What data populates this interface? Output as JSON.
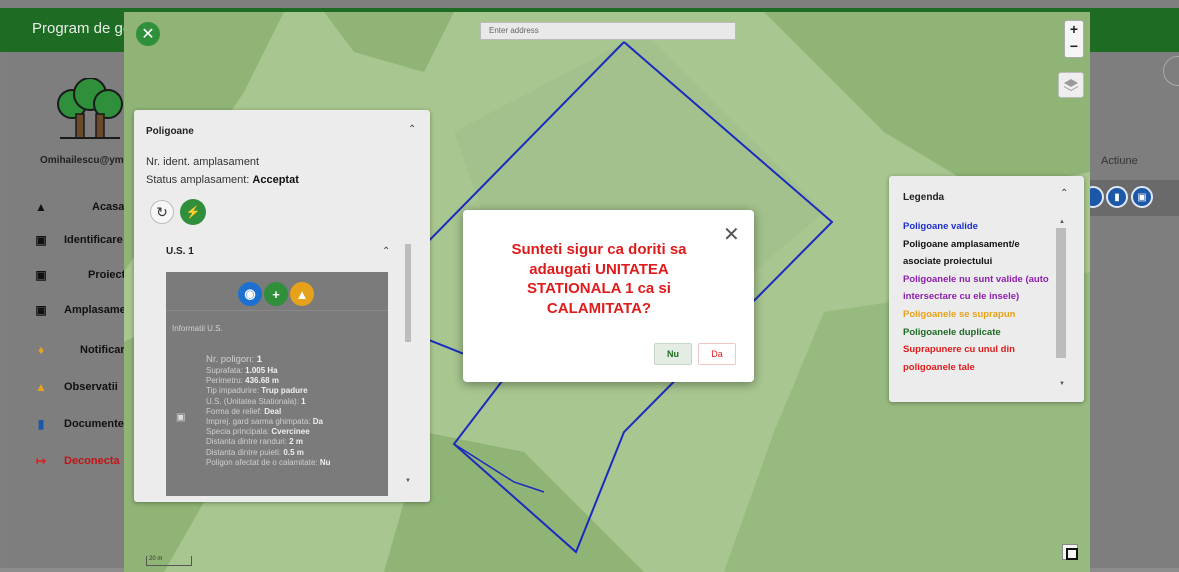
{
  "app": {
    "title": "Program de gest"
  },
  "user": {
    "email": "Omihailescu@ymail"
  },
  "sidebar": {
    "items": [
      {
        "label": "Acasa",
        "icon": "home-icon",
        "color": "#111111"
      },
      {
        "label": "Identificare a",
        "icon": "id-icon",
        "color": "#111111"
      },
      {
        "label": "Proiecte",
        "icon": "id-icon",
        "color": "#111111"
      },
      {
        "label": "Amplasame",
        "icon": "id-icon",
        "color": "#111111"
      },
      {
        "label": "Notificari",
        "icon": "bell-icon",
        "color": "#111111"
      },
      {
        "label": "Observatii",
        "icon": "warning-icon",
        "color": "#111111"
      },
      {
        "label": "Documente c",
        "icon": "document-icon",
        "color": "#111111"
      },
      {
        "label": "Deconecta",
        "icon": "logout-icon",
        "color": "#e01b1b"
      }
    ]
  },
  "table": {
    "actions_header": "Actiune"
  },
  "map": {
    "address_placeholder": "Enter address",
    "zoom_in": "+",
    "zoom_out": "−",
    "scale_label": "20 m"
  },
  "polygons_panel": {
    "title": "Poligoane",
    "nr_ident": "Nr. ident. amplasament",
    "status_label": "Status amplasament:",
    "status_value": "Acceptat",
    "us_title": "U.S. 1",
    "info_label": "Informatii U.S.",
    "details": [
      {
        "k": "Nr. poligon:",
        "v": "1"
      },
      {
        "k": "Suprafata:",
        "v": "1.005 Ha"
      },
      {
        "k": "Perimetru:",
        "v": "436.68 m"
      },
      {
        "k": "Tip impadurire:",
        "v": "Trup padure"
      },
      {
        "k": "U.S. (Unitatea Stationala):",
        "v": "1"
      },
      {
        "k": "Forma de relief:",
        "v": "Deal"
      },
      {
        "k": "Imprej. gard sarma ghimpata:",
        "v": "Da"
      },
      {
        "k": "Specia principala:",
        "v": "Cvercinee"
      },
      {
        "k": "Distanta dintre randuri:",
        "v": "2 m"
      },
      {
        "k": "Distanta dintre puieti:",
        "v": "0.5 m"
      },
      {
        "k": "Poligon afectat de o calamitate:",
        "v": "Nu"
      }
    ]
  },
  "legend": {
    "title": "Legenda",
    "items": [
      {
        "label": "Poligoane valide",
        "color": "#1d2fd0"
      },
      {
        "label": "Poligoane amplasament/e asociate proiectului",
        "color": "#111111"
      },
      {
        "label": "Poligoanele nu sunt valide (auto intersectare cu ele insele)",
        "color": "#8e1fb0"
      },
      {
        "label": "Poligoanele se suprapun",
        "color": "#e6a21a"
      },
      {
        "label": "Poligoanele duplicate",
        "color": "#1e6b24"
      },
      {
        "label": "Suprapunere cu unul din poligoanele tale",
        "color": "#e01b1b"
      }
    ]
  },
  "dialog": {
    "message": "Sunteti sigur ca doriti sa adaugati UNITATEA STATIONALA 1 ca si CALAMITATA?",
    "no_label": "Nu",
    "yes_label": "Da"
  }
}
